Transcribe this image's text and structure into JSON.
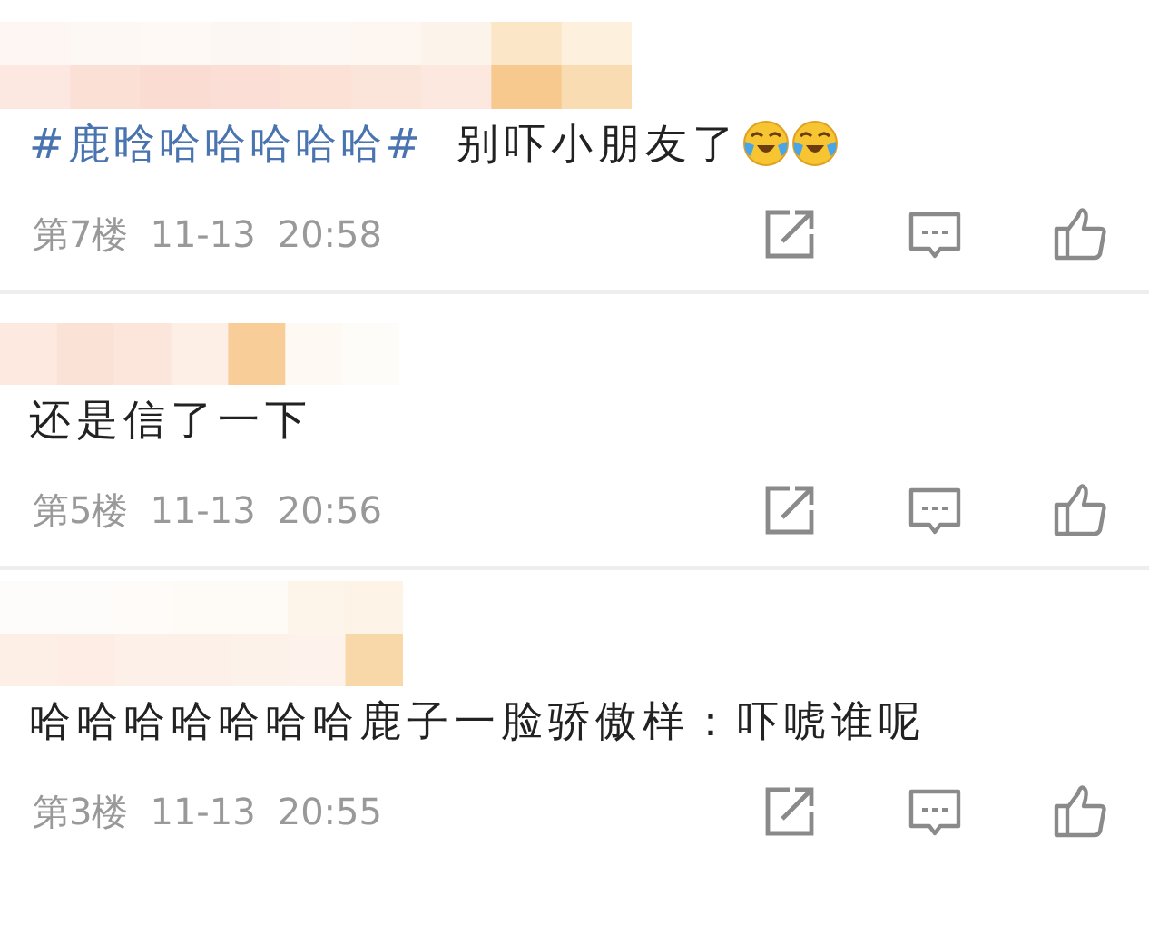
{
  "comments": [
    {
      "segments": [
        {
          "kind": "hashtag",
          "text": "#鹿晗哈哈哈哈哈#"
        },
        {
          "kind": "text",
          "text": "别吓小朋友了"
        },
        {
          "kind": "emoji"
        },
        {
          "kind": "emoji"
        }
      ],
      "floor": "第7楼",
      "date": "11-13",
      "time": "20:58"
    },
    {
      "segments": [
        {
          "kind": "text",
          "text": "还是信了一下"
        }
      ],
      "floor": "第5楼",
      "date": "11-13",
      "time": "20:56"
    },
    {
      "segments": [
        {
          "kind": "text",
          "text": "哈哈哈哈哈哈哈鹿子一脸骄傲样：吓唬谁呢"
        }
      ],
      "floor": "第3楼",
      "date": "11-13",
      "time": "20:55"
    }
  ]
}
